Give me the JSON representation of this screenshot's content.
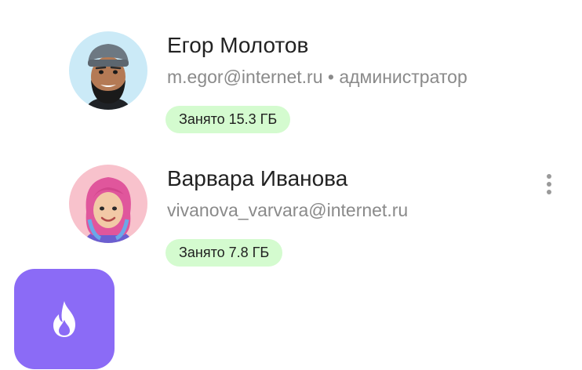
{
  "users": [
    {
      "name": "Егор Молотов",
      "email": "m.egor@internet.ru",
      "separator": "•",
      "role": "администратор",
      "usage": "Занято 15.3 ГБ",
      "avatar_icon": "memoji-bearded-man-icon",
      "avatar_bg": "#cbeaf7"
    },
    {
      "name": "Варвара Иванова",
      "email": "vivanova_varvara@internet.ru",
      "usage": "Занято 7.8 ГБ",
      "avatar_icon": "memoji-pink-hair-woman-icon",
      "avatar_bg": "#f8c2cc",
      "menu_icon": "more-vertical-icon"
    }
  ],
  "app_tile": {
    "icon": "flame-icon",
    "color": "#8b6bf6"
  }
}
